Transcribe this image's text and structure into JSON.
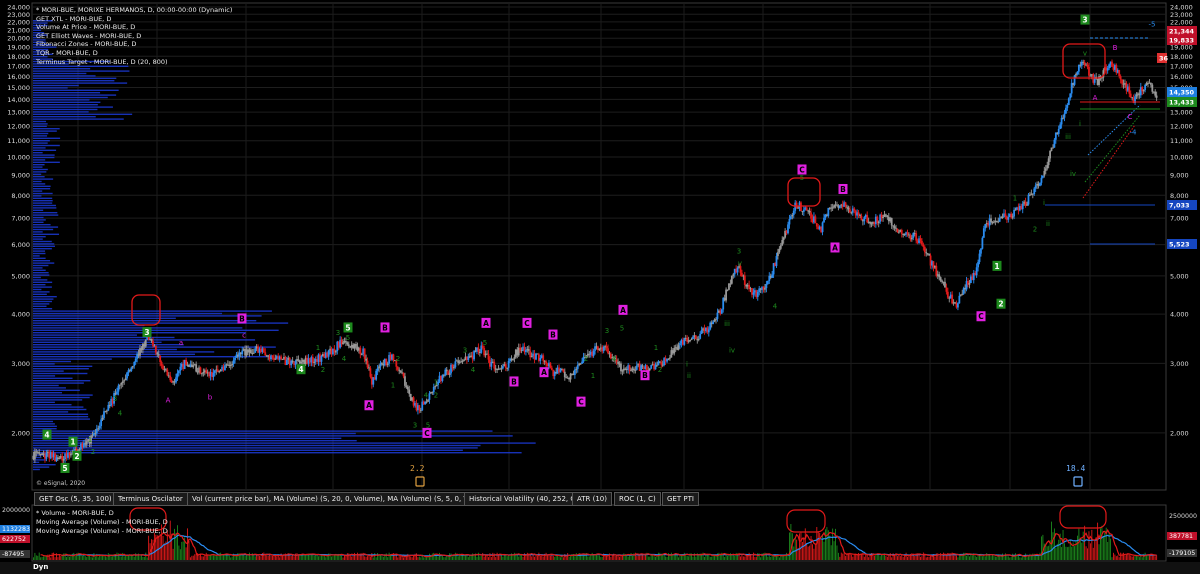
{
  "legend": [
    "* MORI-BUE, MORIXE HERMANOS, D, 00:00-00:00 (Dynamic)",
    "GET XTL - MORI-BUE, D",
    "Volume At Price - MORI-BUE, D",
    "GET Elliott Waves - MORI-BUE, D",
    "Fibonacci Zones - MORI-BUE, D",
    "TQR - MORI-BUE, D",
    "Terminus Target - MORI-BUE, D (20, 800)"
  ],
  "copyright": "© eSignal, 2020",
  "indicator_tabs": [
    "GET Osc (5, 35, 100)",
    "Terminus Oscilator",
    "Vol (current price bar), MA (Volume) (S, 20, 0, Volume), MA (Volume) (S, 5, 0, Volume)",
    "Historical Volatility (40, 252, C)",
    "ATR (10)",
    "ROC (1, C)",
    "GET PTI"
  ],
  "volume_legend": [
    "* Volume - MORI-BUE, D",
    "Moving Average (Volume) - MORI-BUE, D",
    "Moving Average (Volume) - MORI-BUE, D"
  ],
  "dyn_label": "Dyn",
  "pti_left": "2.2",
  "pti_right": "18.4",
  "colors": {
    "up": "#2a8cf0",
    "down": "#e21a1a",
    "neutral": "#9a9a9a",
    "wave_green": "#1d8a1d",
    "wave_magenta": "#e020e0"
  },
  "chart_data": {
    "type": "candlestick",
    "y_scale": "log",
    "y_ticks": [
      "24,000",
      "23,000",
      "22,000",
      "21,000",
      "20,000",
      "19,000",
      "18,000",
      "17,000",
      "16,000",
      "15,000",
      "14,000",
      "13,000",
      "12,000",
      "11,000",
      "10,000",
      "9,000",
      "8,000",
      "7,000",
      "6,000",
      "5,000",
      "4,000",
      "3,000",
      "2,000"
    ],
    "y_ticks_right": [
      "24,000",
      "23,000",
      "22,000",
      "21,000",
      "20,000",
      "19,000",
      "18,000",
      "17,000",
      "16,000",
      "15,000",
      "14,000",
      "13,000",
      "12,000",
      "11,000",
      "10,000",
      "9,000",
      "8,000",
      "7,000",
      "6,000",
      "5,000",
      "4,000",
      "3,000",
      "2,000"
    ],
    "x_labels": [
      "may.",
      "jun.",
      "jul.",
      "ago.",
      "sep.",
      "oct.",
      "nov.",
      "dic.",
      "2020",
      "feb.",
      "mar.",
      "abr.",
      "may."
    ],
    "price_badges": [
      {
        "value": "21,344",
        "color": "#c0102a"
      },
      {
        "value": "19,833",
        "color": "#c0102a"
      },
      {
        "value": "36",
        "color": "#e03030"
      },
      {
        "value": "14,350",
        "color": "#1f7fe0"
      },
      {
        "value": "13,433",
        "color": "#1d8a1d"
      },
      {
        "value": "7,033",
        "color": "#1546c0"
      },
      {
        "value": "5,523",
        "color": "#1546c0"
      }
    ],
    "path": [
      [
        0,
        1750
      ],
      [
        10,
        1760
      ],
      [
        20,
        1720
      ],
      [
        30,
        1800
      ],
      [
        38,
        1880
      ],
      [
        45,
        2050
      ],
      [
        52,
        2300
      ],
      [
        58,
        2500
      ],
      [
        65,
        2800
      ],
      [
        72,
        3100
      ],
      [
        80,
        3500
      ],
      [
        86,
        3200
      ],
      [
        92,
        2900
      ],
      [
        98,
        2700
      ],
      [
        106,
        3000
      ],
      [
        114,
        2900
      ],
      [
        122,
        2800
      ],
      [
        130,
        2850
      ],
      [
        138,
        2950
      ],
      [
        145,
        3200
      ],
      [
        155,
        3250
      ],
      [
        165,
        3150
      ],
      [
        175,
        3050
      ],
      [
        185,
        3000
      ],
      [
        195,
        3050
      ],
      [
        205,
        3150
      ],
      [
        215,
        3400
      ],
      [
        222,
        3350
      ],
      [
        230,
        3200
      ],
      [
        236,
        2700
      ],
      [
        242,
        2950
      ],
      [
        250,
        3150
      ],
      [
        256,
        2850
      ],
      [
        262,
        2500
      ],
      [
        268,
        2300
      ],
      [
        274,
        2400
      ],
      [
        282,
        2700
      ],
      [
        290,
        2900
      ],
      [
        298,
        3050
      ],
      [
        305,
        3100
      ],
      [
        312,
        3300
      ],
      [
        318,
        3000
      ],
      [
        325,
        2850
      ],
      [
        332,
        3050
      ],
      [
        340,
        3300
      ],
      [
        348,
        3150
      ],
      [
        356,
        3050
      ],
      [
        362,
        2850
      ],
      [
        368,
        2900
      ],
      [
        372,
        2750
      ],
      [
        380,
        3000
      ],
      [
        388,
        3200
      ],
      [
        396,
        3300
      ],
      [
        404,
        3100
      ],
      [
        410,
        2900
      ],
      [
        418,
        2950
      ],
      [
        426,
        2900
      ],
      [
        434,
        2950
      ],
      [
        441,
        3100
      ],
      [
        448,
        3300
      ],
      [
        455,
        3450
      ],
      [
        462,
        3500
      ],
      [
        470,
        3700
      ],
      [
        478,
        4100
      ],
      [
        484,
        4800
      ],
      [
        490,
        5300
      ],
      [
        496,
        4700
      ],
      [
        503,
        4500
      ],
      [
        510,
        4700
      ],
      [
        517,
        5500
      ],
      [
        524,
        6500
      ],
      [
        530,
        7600
      ],
      [
        536,
        7400
      ],
      [
        542,
        7000
      ],
      [
        548,
        6600
      ],
      [
        554,
        7400
      ],
      [
        560,
        7600
      ],
      [
        566,
        7500
      ],
      [
        572,
        7200
      ],
      [
        578,
        7000
      ],
      [
        585,
        6900
      ],
      [
        592,
        7100
      ],
      [
        598,
        6800
      ],
      [
        605,
        6400
      ],
      [
        612,
        6300
      ],
      [
        618,
        6100
      ],
      [
        624,
        5400
      ],
      [
        630,
        5000
      ],
      [
        636,
        4500
      ],
      [
        642,
        4200
      ],
      [
        648,
        4700
      ],
      [
        654,
        5000
      ],
      [
        658,
        5600
      ],
      [
        662,
        6800
      ],
      [
        670,
        7000
      ],
      [
        678,
        7100
      ],
      [
        686,
        7400
      ],
      [
        694,
        8000
      ],
      [
        700,
        8600
      ],
      [
        705,
        9600
      ],
      [
        710,
        11000
      ],
      [
        715,
        12500
      ],
      [
        720,
        14200
      ],
      [
        725,
        16500
      ],
      [
        730,
        17500
      ],
      [
        735,
        16000
      ],
      [
        740,
        15400
      ],
      [
        745,
        16800
      ],
      [
        750,
        17300
      ],
      [
        755,
        16000
      ],
      [
        760,
        15000
      ],
      [
        765,
        14000
      ],
      [
        770,
        14700
      ],
      [
        775,
        15400
      ],
      [
        781,
        14350
      ]
    ],
    "elliott_labels": [
      {
        "text": "3",
        "style": "box-green",
        "x": 147,
        "y": 3600
      },
      {
        "text": "4",
        "style": "box-green",
        "x": 47,
        "y": 1980
      },
      {
        "text": "1",
        "style": "box-green",
        "x": 73,
        "y": 1900
      },
      {
        "text": "2",
        "style": "box-green",
        "x": 77,
        "y": 1750
      },
      {
        "text": "5",
        "style": "box-green",
        "x": 65,
        "y": 1630
      },
      {
        "text": "4",
        "style": "box-green",
        "x": 301,
        "y": 2900
      },
      {
        "text": "5",
        "style": "box-green",
        "x": 348,
        "y": 3700
      },
      {
        "text": "C",
        "style": "box-magenta",
        "x": 802,
        "y": 9300
      },
      {
        "text": "B",
        "style": "box-magenta",
        "x": 843,
        "y": 8300
      },
      {
        "text": "A",
        "style": "box-magenta",
        "x": 835,
        "y": 5900
      },
      {
        "text": "1",
        "style": "box-green",
        "x": 997,
        "y": 5300
      },
      {
        "text": "2",
        "style": "box-green",
        "x": 1001,
        "y": 4250
      },
      {
        "text": "C",
        "style": "box-magenta",
        "x": 981,
        "y": 3950
      },
      {
        "text": "3",
        "style": "box-green",
        "x": 1085,
        "y": 22300
      },
      {
        "text": "B",
        "style": "box-magenta",
        "x": 242,
        "y": 3900
      },
      {
        "text": "B",
        "style": "box-magenta",
        "x": 385,
        "y": 3700
      },
      {
        "text": "A",
        "style": "box-magenta",
        "x": 369,
        "y": 2350
      },
      {
        "text": "C",
        "style": "box-magenta",
        "x": 427,
        "y": 2000
      },
      {
        "text": "A",
        "style": "box-magenta",
        "x": 486,
        "y": 3800
      },
      {
        "text": "C",
        "style": "box-magenta",
        "x": 527,
        "y": 3800
      },
      {
        "text": "B",
        "style": "box-magenta",
        "x": 553,
        "y": 3550
      },
      {
        "text": "A",
        "style": "box-magenta",
        "x": 544,
        "y": 2850
      },
      {
        "text": "B",
        "style": "box-magenta",
        "x": 514,
        "y": 2700
      },
      {
        "text": "C",
        "style": "box-magenta",
        "x": 581,
        "y": 2400
      },
      {
        "text": "A",
        "style": "box-magenta",
        "x": 623,
        "y": 4100
      },
      {
        "text": "B",
        "style": "box-magenta",
        "x": 645,
        "y": 2800
      }
    ],
    "small_labels": [
      {
        "text": "3",
        "color": "#1d8a1d",
        "x": 115,
        "y": 2450
      },
      {
        "text": "4",
        "color": "#1d8a1d",
        "x": 120,
        "y": 2250
      },
      {
        "text": "2",
        "color": "#1d8a1d",
        "x": 93,
        "y": 1800
      },
      {
        "text": "1",
        "color": "#1d8a1d",
        "x": 90,
        "y": 1930
      },
      {
        "text": "A",
        "color": "#e020e0",
        "x": 168,
        "y": 2430
      },
      {
        "text": "a",
        "color": "#e020e0",
        "x": 181,
        "y": 3400
      },
      {
        "text": "b",
        "color": "#e020e0",
        "x": 210,
        "y": 2470
      },
      {
        "text": "c",
        "color": "#e020e0",
        "x": 244,
        "y": 3550
      },
      {
        "text": "2",
        "color": "#1d8a1d",
        "x": 323,
        "y": 2900
      },
      {
        "text": "1",
        "color": "#1d8a1d",
        "x": 318,
        "y": 3300
      },
      {
        "text": "3",
        "color": "#1d8a1d",
        "x": 338,
        "y": 3600
      },
      {
        "text": "4",
        "color": "#1d8a1d",
        "x": 344,
        "y": 3100
      },
      {
        "text": "5",
        "color": "#1d8a1d",
        "x": 348,
        "y": 3500
      },
      {
        "text": "2",
        "color": "#1d8a1d",
        "x": 398,
        "y": 3100
      },
      {
        "text": "1",
        "color": "#1d8a1d",
        "x": 393,
        "y": 2650
      },
      {
        "text": "3",
        "color": "#1d8a1d",
        "x": 415,
        "y": 2100
      },
      {
        "text": "5",
        "color": "#1d8a1d",
        "x": 428,
        "y": 2100
      },
      {
        "text": "4",
        "color": "#1d8a1d",
        "x": 426,
        "y": 2500
      },
      {
        "text": "2",
        "color": "#1d8a1d",
        "x": 436,
        "y": 2500
      },
      {
        "text": "1",
        "color": "#1d8a1d",
        "x": 436,
        "y": 2700
      },
      {
        "text": "3",
        "color": "#1d8a1d",
        "x": 465,
        "y": 3250
      },
      {
        "text": "4",
        "color": "#1d8a1d",
        "x": 473,
        "y": 2900
      },
      {
        "text": "5",
        "color": "#1d8a1d",
        "x": 485,
        "y": 3400
      },
      {
        "text": "2",
        "color": "#1d8a1d",
        "x": 586,
        "y": 3100
      },
      {
        "text": "1",
        "color": "#1d8a1d",
        "x": 593,
        "y": 2800
      },
      {
        "text": "3",
        "color": "#1d8a1d",
        "x": 607,
        "y": 3650
      },
      {
        "text": "5",
        "color": "#1d8a1d",
        "x": 622,
        "y": 3700
      },
      {
        "text": "4",
        "color": "#1d8a1d",
        "x": 614,
        "y": 3100
      },
      {
        "text": "1",
        "color": "#1d8a1d",
        "x": 656,
        "y": 3300
      },
      {
        "text": "2",
        "color": "#1d8a1d",
        "x": 660,
        "y": 2900
      },
      {
        "text": "i",
        "color": "#1d8a1d",
        "x": 687,
        "y": 3000
      },
      {
        "text": "ii",
        "color": "#1d8a1d",
        "x": 689,
        "y": 2800
      },
      {
        "text": "iii",
        "color": "#1d8a1d",
        "x": 727,
        "y": 3800
      },
      {
        "text": "iv",
        "color": "#1d8a1d",
        "x": 732,
        "y": 3250
      },
      {
        "text": "3",
        "color": "#1d8a1d",
        "x": 739,
        "y": 5800
      },
      {
        "text": "v",
        "color": "#1d8a1d",
        "x": 740,
        "y": 5400
      },
      {
        "text": "4",
        "color": "#1d8a1d",
        "x": 775,
        "y": 4200
      },
      {
        "text": "5",
        "color": "#1d8a1d",
        "x": 802,
        "y": 8900
      },
      {
        "text": "1",
        "color": "#1d8a1d",
        "x": 1015,
        "y": 7900
      },
      {
        "text": "2",
        "color": "#1d8a1d",
        "x": 1035,
        "y": 6600
      },
      {
        "text": "ii",
        "color": "#1d8a1d",
        "x": 1048,
        "y": 6800
      },
      {
        "text": "i",
        "color": "#1d8a1d",
        "x": 1044,
        "y": 7700
      },
      {
        "text": "iii",
        "color": "#1d8a1d",
        "x": 1068,
        "y": 11300
      },
      {
        "text": "iv",
        "color": "#1d8a1d",
        "x": 1073,
        "y": 9100
      },
      {
        "text": "v",
        "color": "#1d8a1d",
        "x": 1085,
        "y": 18400
      },
      {
        "text": "A",
        "color": "#e020e0",
        "x": 1095,
        "y": 14200
      },
      {
        "text": "B",
        "color": "#e020e0",
        "x": 1115,
        "y": 19000
      },
      {
        "text": "C",
        "color": "#e020e0",
        "x": 1130,
        "y": 12700
      },
      {
        "text": "i",
        "color": "#1d8a1d",
        "x": 1080,
        "y": 12200
      },
      {
        "text": "-5",
        "color": "#2a8cf0",
        "x": 1152,
        "y": 21800
      },
      {
        "text": "-4",
        "color": "#2a8cf0",
        "x": 1133,
        "y": 11600
      }
    ]
  }
}
